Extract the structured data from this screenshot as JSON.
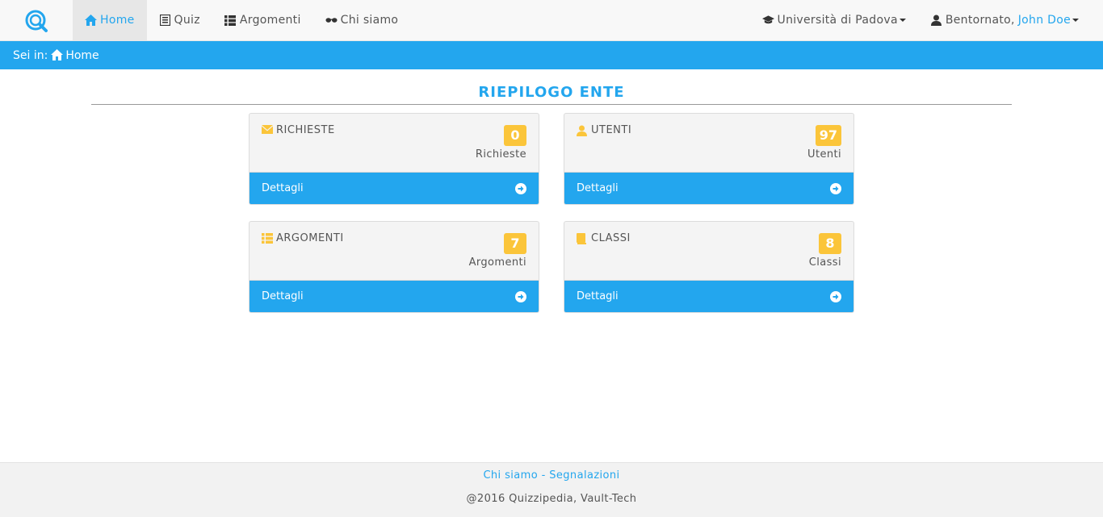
{
  "nav": {
    "items": [
      {
        "label": "Home",
        "icon": "home-icon"
      },
      {
        "label": "Quiz",
        "icon": "list-alt-icon"
      },
      {
        "label": "Argomenti",
        "icon": "th-list-icon"
      },
      {
        "label": "Chi siamo",
        "icon": "sunglasses-icon"
      }
    ],
    "institution": "Università di Padova",
    "greeting": "Bentornato,",
    "user": "John Doe"
  },
  "breadcrumb": {
    "prefix": "Sei in:",
    "current": "Home"
  },
  "title": "RIEPILOGO ENTE",
  "panels": [
    {
      "label": "RICHIESTE",
      "icon": "envelope-icon",
      "count": "0",
      "sub": "Richieste",
      "link": "Dettagli"
    },
    {
      "label": "UTENTI",
      "icon": "user-icon",
      "count": "97",
      "sub": "Utenti",
      "link": "Dettagli"
    },
    {
      "label": "ARGOMENTI",
      "icon": "th-list-icon",
      "count": "7",
      "sub": "Argomenti",
      "link": "Dettagli"
    },
    {
      "label": "CLASSI",
      "icon": "book-icon",
      "count": "8",
      "sub": "Classi",
      "link": "Dettagli"
    }
  ],
  "footer": {
    "link1": "Chi siamo",
    "separator": " - ",
    "link2": "Segnalazioni",
    "copyright": "@2016 Quizzipedia, Vault-Tech"
  },
  "colors": {
    "accent": "#23a6ee",
    "badge": "#fbc53a",
    "navbar": "#f8f8f8"
  }
}
